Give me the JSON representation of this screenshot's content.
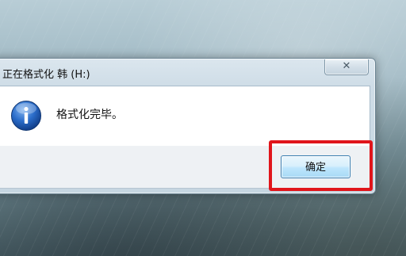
{
  "dialog": {
    "title": "正在格式化 韩 (H:)",
    "message": "格式化完毕。",
    "close_label": "✕",
    "ok_label": "确定",
    "icon": "info-icon"
  },
  "colors": {
    "highlight": "#e0151b",
    "icon_blue": "#1f5fbf",
    "ok_border": "#3c7fb1"
  }
}
